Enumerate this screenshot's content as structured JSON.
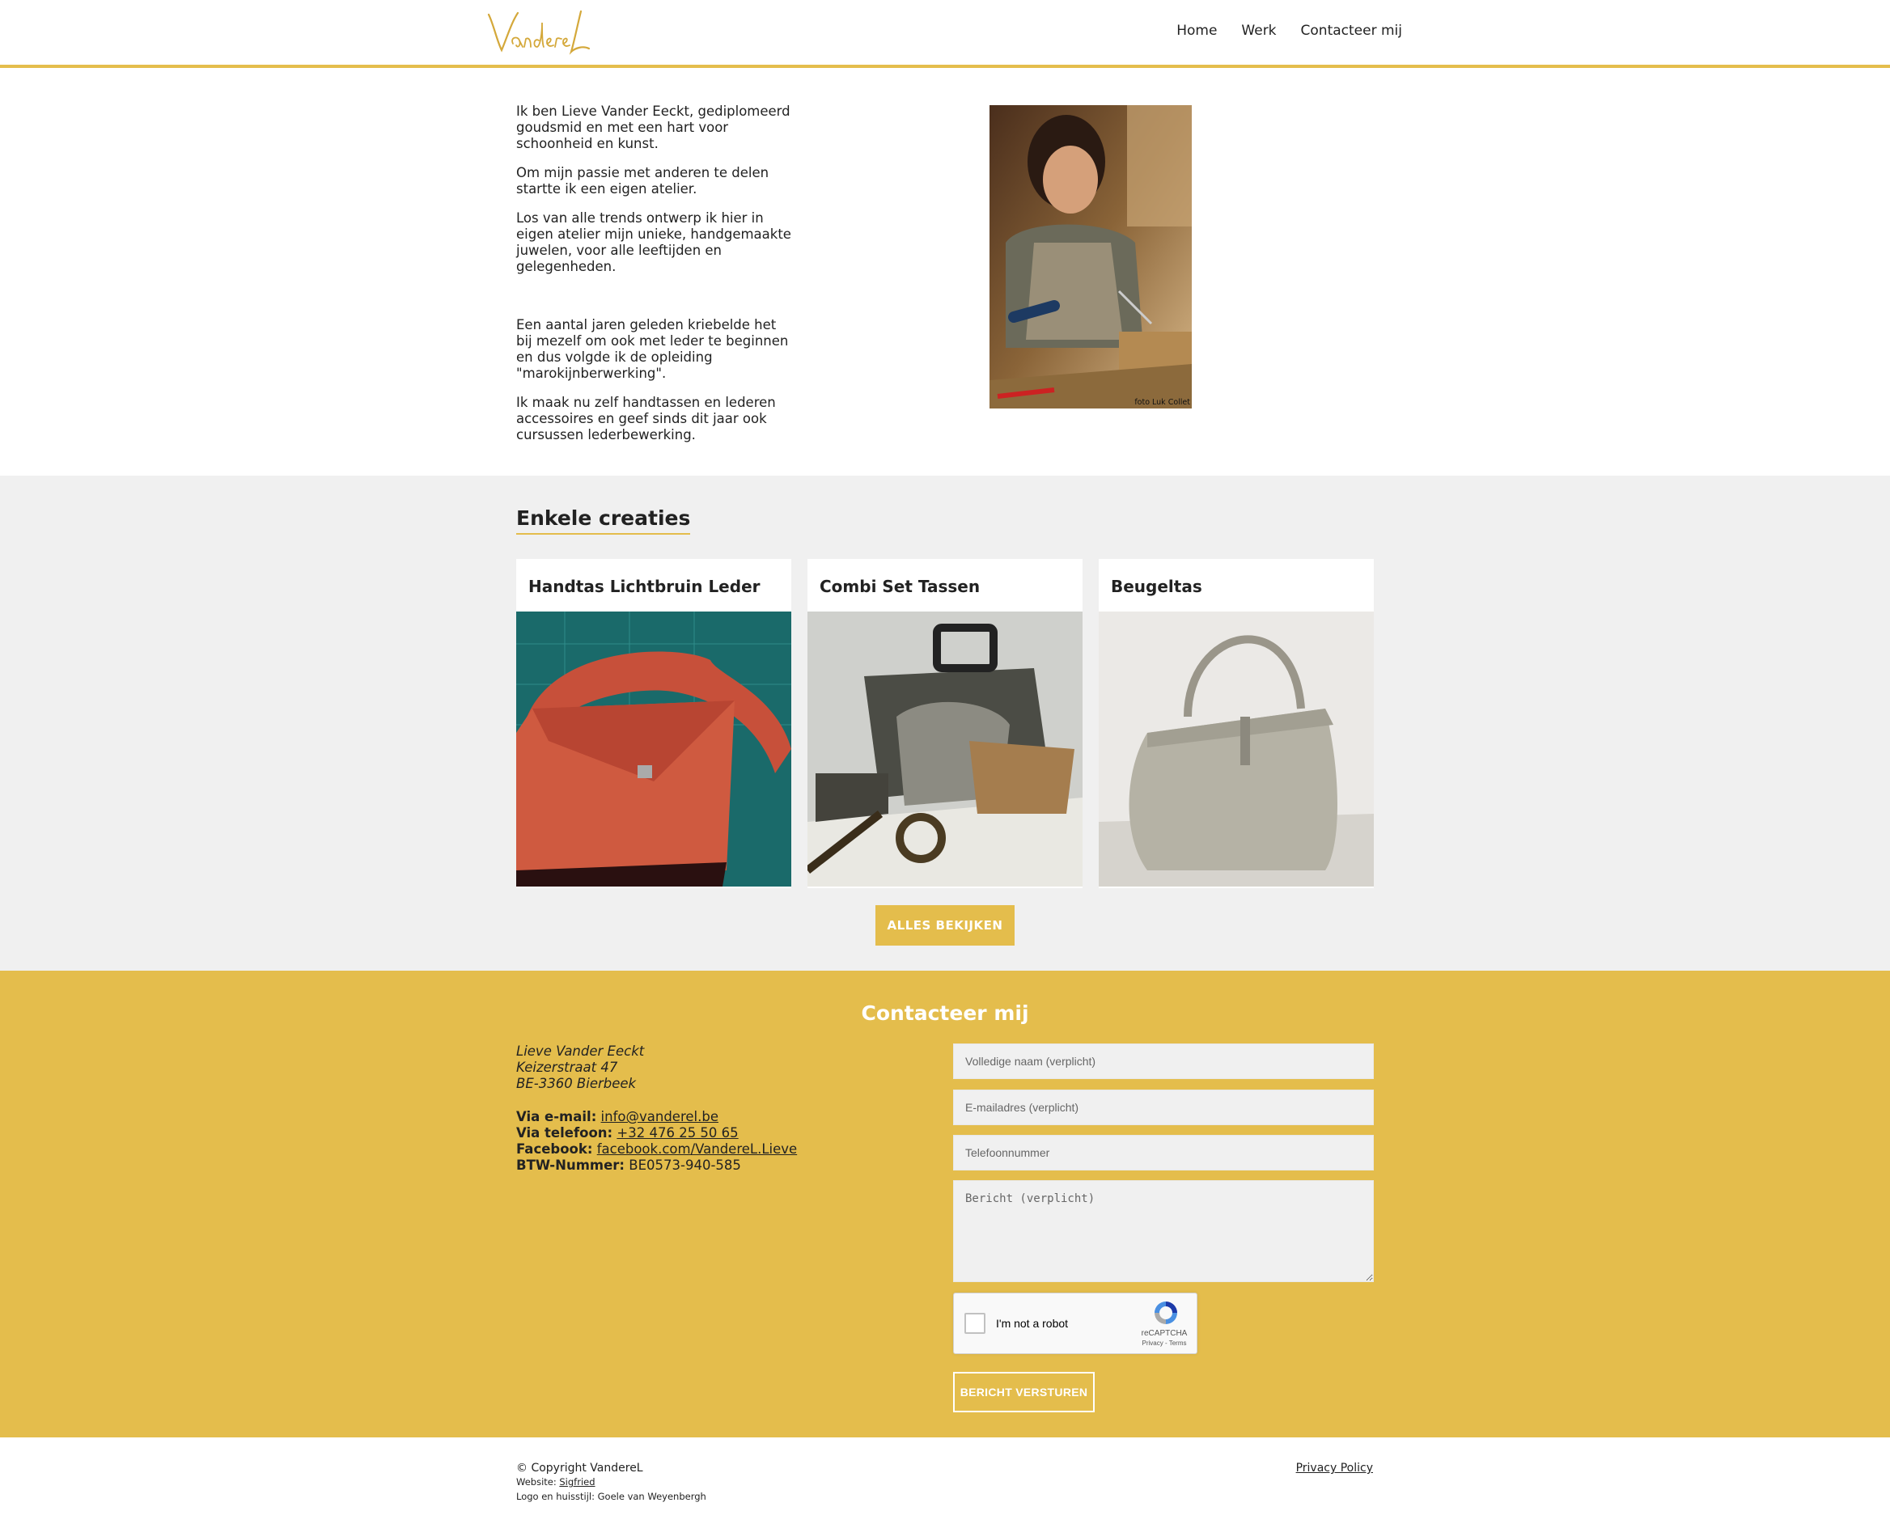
{
  "header": {
    "logo_text": "VandereL",
    "nav": [
      "Home",
      "Werk",
      "Contacteer mij"
    ]
  },
  "intro": {
    "paragraphs": [
      "Ik ben Lieve Vander Eeckt, gediplomeerd goudsmid en met een hart voor schoonheid en kunst.",
      "Om mijn passie met anderen te delen startte ik een eigen atelier.",
      "Los van alle trends ontwerp ik hier in eigen atelier mijn unieke, handgemaakte juwelen, voor alle leeftijden en gelegenheden.",
      "Een aantal jaren geleden kriebelde het bij mezelf om ook met leder te beginnen en dus volgde ik de opleiding \"marokijnberwerking\".",
      "Ik maak nu zelf handtassen en lederen accessoires en geef sinds dit jaar ook cursussen lederbewerking."
    ],
    "photo_credit": "foto Luk Collet"
  },
  "creations": {
    "title": "Enkele creaties",
    "items": [
      {
        "title": "Handtas Lichtbruin Leder"
      },
      {
        "title": "Combi Set Tassen"
      },
      {
        "title": "Beugeltas"
      }
    ],
    "button": "ALLES BEKIJKEN"
  },
  "contact": {
    "title": "Contacteer mij",
    "address": [
      "Lieve Vander Eeckt",
      "Keizerstraat 47",
      "BE-3360 Bierbeek"
    ],
    "email_label": "Via e-mail:",
    "email": "info@vanderel.be",
    "phone_label": "Via telefoon:",
    "phone": "+32 476 25 50 65",
    "facebook_label": "Facebook:",
    "facebook": "facebook.com/VandereL.Lieve",
    "vat_label": "BTW-Nummer:",
    "vat": "BE0573-940-585",
    "form": {
      "name_placeholder": "Volledige naam (verplicht)",
      "email_placeholder": "E-mailadres (verplicht)",
      "phone_placeholder": "Telefoonnummer",
      "message_placeholder": "Bericht (verplicht)",
      "captcha_label": "I'm not a robot",
      "captcha_brand": "reCAPTCHA",
      "captcha_links": "Privacy - Terms",
      "submit": "BERICHT VERSTUREN"
    }
  },
  "footer": {
    "copyright": "© Copyright VandereL",
    "website_label": "Website:",
    "website_link": "Sigfried",
    "credits": "Logo en huisstijl: Goele van Weyenbergh",
    "privacy": "Privacy Policy"
  },
  "colors": {
    "accent": "#e4bd4c",
    "section_gray": "#f0f0f0"
  }
}
